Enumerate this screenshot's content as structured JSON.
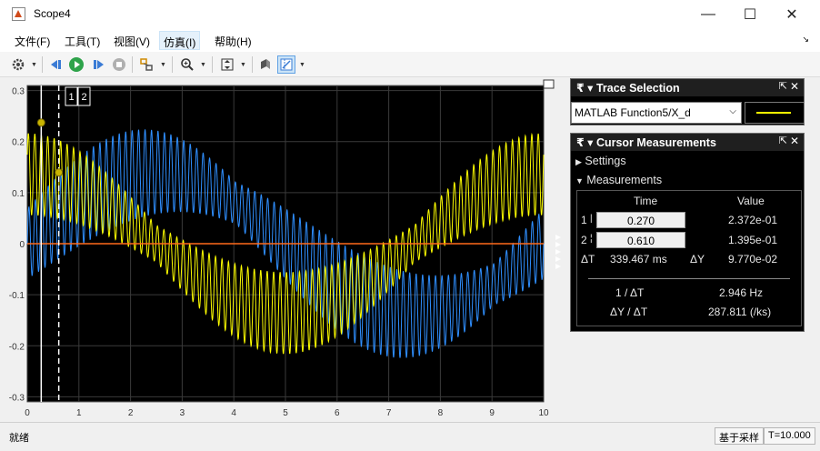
{
  "window": {
    "title": "Scope4",
    "minimize": "—",
    "maximize": "☐",
    "close": "✕"
  },
  "menu": {
    "items": [
      "文件(F)",
      "工具(T)",
      "视图(V)",
      "仿真(I)",
      "帮助(H)"
    ],
    "overflow": "↘"
  },
  "toolbar": {
    "icons": [
      "settings-icon",
      "step-back-icon",
      "run-icon",
      "step-forward-icon",
      "stop-icon",
      "signal-tools-icon",
      "zoom-icon",
      "scale-axes-icon",
      "highlight-icon",
      "cursor-measurements-icon"
    ]
  },
  "plot": {
    "background": "#000000",
    "grid_color": "#3a3a3a",
    "axis_text_color": "#c8c8c8",
    "xticks": [
      "0",
      "1",
      "2",
      "3",
      "4",
      "5",
      "6",
      "7",
      "8",
      "9",
      "10"
    ],
    "yticks": [
      "0.3",
      "0.2",
      "0.1",
      "0",
      "-0.1",
      "-0.2",
      "-0.3"
    ],
    "cursor_labels": [
      "1",
      "2"
    ],
    "expand_icon": "▣"
  },
  "chart_data": {
    "type": "line",
    "title": "",
    "xlabel": "",
    "ylabel": "",
    "xlim": [
      0,
      10
    ],
    "ylim": [
      -0.31,
      0.31
    ],
    "grid": true,
    "series": [
      {
        "color": "#ffff00",
        "envelope": "0.17 * cos(2*pi*t/10)",
        "carrier_hz": 8,
        "amplitude": 0.08
      },
      {
        "color": "#2f8fff",
        "envelope": "0.14 * sin(2*pi*t/10)",
        "carrier_hz": 8,
        "amplitude": 0.09
      },
      {
        "color": "#ff6a1a",
        "values_constant": 0
      }
    ],
    "cursors": [
      {
        "label": "1",
        "x": 0.27,
        "y": 0.2372,
        "style": "solid"
      },
      {
        "label": "2",
        "x": 0.61,
        "y": 0.1395,
        "style": "dashed"
      }
    ]
  },
  "trace_selection": {
    "title": "Trace Selection",
    "selected": "MATLAB Function5/X_d",
    "swatch_color": "#ffff00"
  },
  "cursor_measurements": {
    "title": "Cursor Measurements",
    "settings": "Settings",
    "measurements": "Measurements",
    "col_time": "Time",
    "col_value": "Value",
    "row1_label": "1",
    "row1_time": "0.270",
    "row1_value": "2.372e-01",
    "row2_label": "2",
    "row2_time": "0.610",
    "row2_value": "1.395e-01",
    "dt_label": "ΔT",
    "dt_value": "339.467 ms",
    "dy_label": "ΔY",
    "dy_value": "9.770e-02",
    "inv_dt_label": "1 / ΔT",
    "inv_dt_value": "2.946 Hz",
    "dy_dt_label": "ΔY / ΔT",
    "dy_dt_value": "287.811 (/ks)"
  },
  "status": {
    "left": "就绪",
    "mode": "基于采样",
    "time": "T=10.000"
  }
}
